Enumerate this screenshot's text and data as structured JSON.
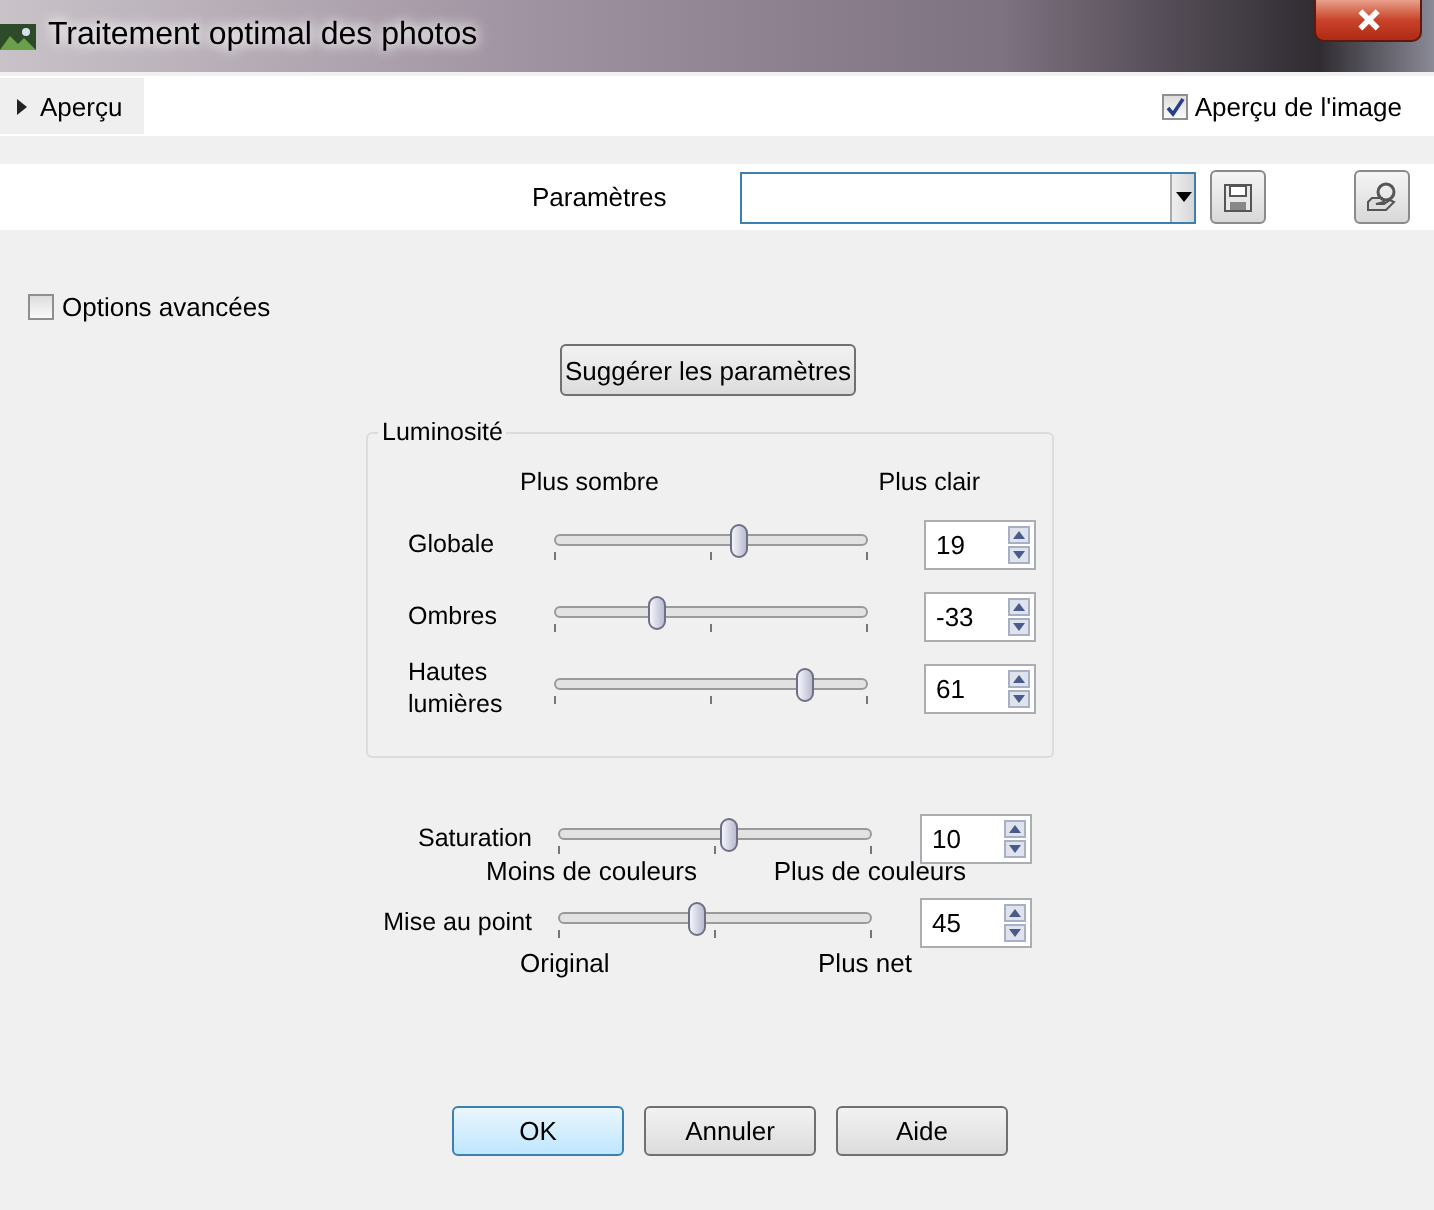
{
  "window": {
    "title": "Traitement optimal des photos"
  },
  "preview": {
    "label": "Aperçu",
    "expanded": false
  },
  "image_preview": {
    "label": "Aperçu de l'image",
    "checked": true
  },
  "presets": {
    "label": "Paramètres"
  },
  "advanced_options": {
    "label": "Options avancées",
    "checked": false
  },
  "suggest_button": "Suggérer les paramètres",
  "brightness": {
    "title": "Luminosité",
    "left_label": "Plus sombre",
    "right_label": "Plus clair",
    "sliders": [
      {
        "label": "Globale",
        "level": 0.595,
        "value": "19"
      },
      {
        "label": "Ombres",
        "level": 0.335,
        "value": "-33"
      },
      {
        "label": "Hautes lumières",
        "level": 0.805,
        "value": "61"
      }
    ]
  },
  "saturation": {
    "label": "Saturation",
    "level": 0.55,
    "value": "10",
    "left_label": "Moins de couleurs",
    "right_label": "Plus de couleurs"
  },
  "focus": {
    "label": "Mise au point",
    "level": 0.45,
    "value": "45",
    "left_label": "Original",
    "right_label": "Plus net"
  },
  "buttons": [
    {
      "label": "OK",
      "default": true
    },
    {
      "label": "Annuler",
      "default": false
    },
    {
      "label": "Aide",
      "default": false
    }
  ]
}
